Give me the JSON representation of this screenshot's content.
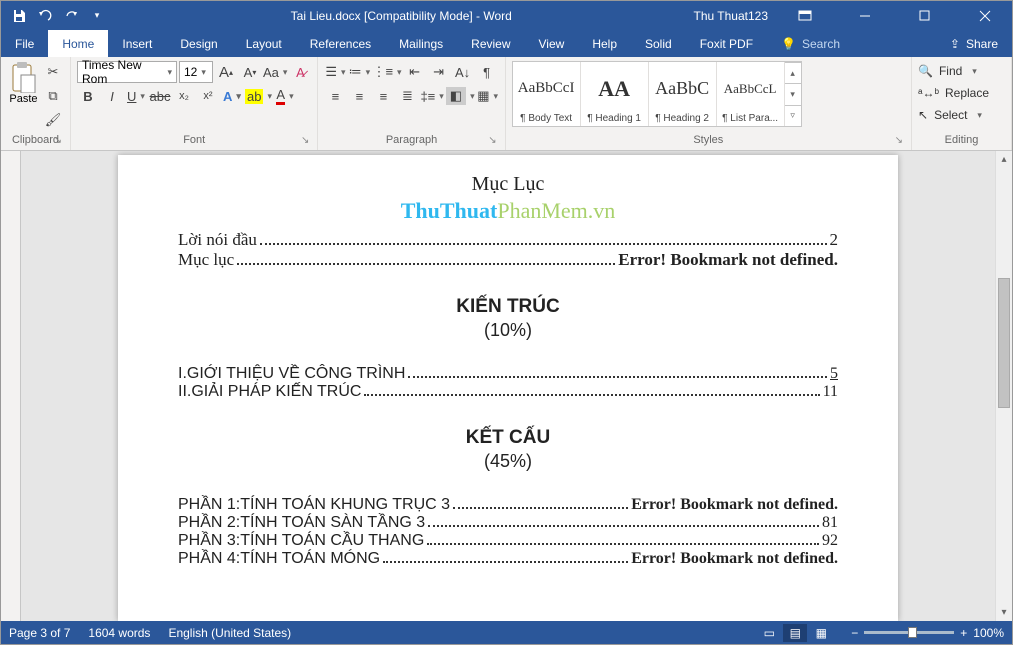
{
  "title": "Tai Lieu.docx  [Compatibility Mode]  -  Word",
  "user": "Thu Thuat123",
  "menu": {
    "file": "File",
    "home": "Home",
    "insert": "Insert",
    "design": "Design",
    "layout": "Layout",
    "references": "References",
    "mailings": "Mailings",
    "review": "Review",
    "view": "View",
    "help": "Help",
    "solid": "Solid",
    "foxit": "Foxit PDF",
    "search": "Search",
    "share": "Share"
  },
  "font": {
    "name": "Times New Rom",
    "size": "12"
  },
  "groups": {
    "clipboard": "Clipboard",
    "font": "Font",
    "paragraph": "Paragraph",
    "styles": "Styles",
    "editing": "Editing"
  },
  "clipboard": {
    "paste": "Paste"
  },
  "styles": [
    {
      "preview": "AaBbCcI",
      "label": "¶ Body Text",
      "ps": "15px"
    },
    {
      "preview": "AA",
      "label": "¶ Heading 1",
      "ps": "22px"
    },
    {
      "preview": "AaBbC",
      "label": "¶ Heading 2",
      "ps": "18px"
    },
    {
      "preview": "AaBbCcL",
      "label": "¶ List Para...",
      "ps": "13px"
    }
  ],
  "editing": {
    "find": "Find",
    "replace": "Replace",
    "select": "Select"
  },
  "doc": {
    "title": "Mục Lục",
    "watermark_a": "ThuThuat",
    "watermark_b": "PhanMem",
    "watermark_c": ".vn",
    "toc1": [
      {
        "t": "Lời nói đầu",
        "p": "2"
      },
      {
        "t": "Mục lục",
        "p": "Error! Bookmark not defined.",
        "err": true
      }
    ],
    "sec1": "KIẾN TRÚC",
    "sub1": "(10%)",
    "toc2": [
      {
        "t": "I.GIỚI THIỆU VỀ CÔNG TRÌNH",
        "p": "5",
        "u": true
      },
      {
        "t": "II.GIẢI PHÁP KIẾN TRÚC",
        "p": "11"
      }
    ],
    "sec2": "KẾT CẤU",
    "sub2": "(45%)",
    "toc3": [
      {
        "t": "PHẦN 1:TÍNH TOÁN KHUNG TRỤC 3",
        "p": "Error! Bookmark not defined.",
        "err": true
      },
      {
        "t": "PHẦN 2:TÍNH TOÁN SÀN TẦNG 3",
        "p": "81"
      },
      {
        "t": "PHẦN 3:TÍNH TOÁN CẦU THANG",
        "p": "92"
      },
      {
        "t": "PHẦN 4:TÍNH TOÁN MÓNG",
        "p": "Error! Bookmark not defined.",
        "err": true
      }
    ]
  },
  "status": {
    "page": "Page 3 of 7",
    "words": "1604 words",
    "lang": "English (United States)",
    "zoom": "100%"
  }
}
